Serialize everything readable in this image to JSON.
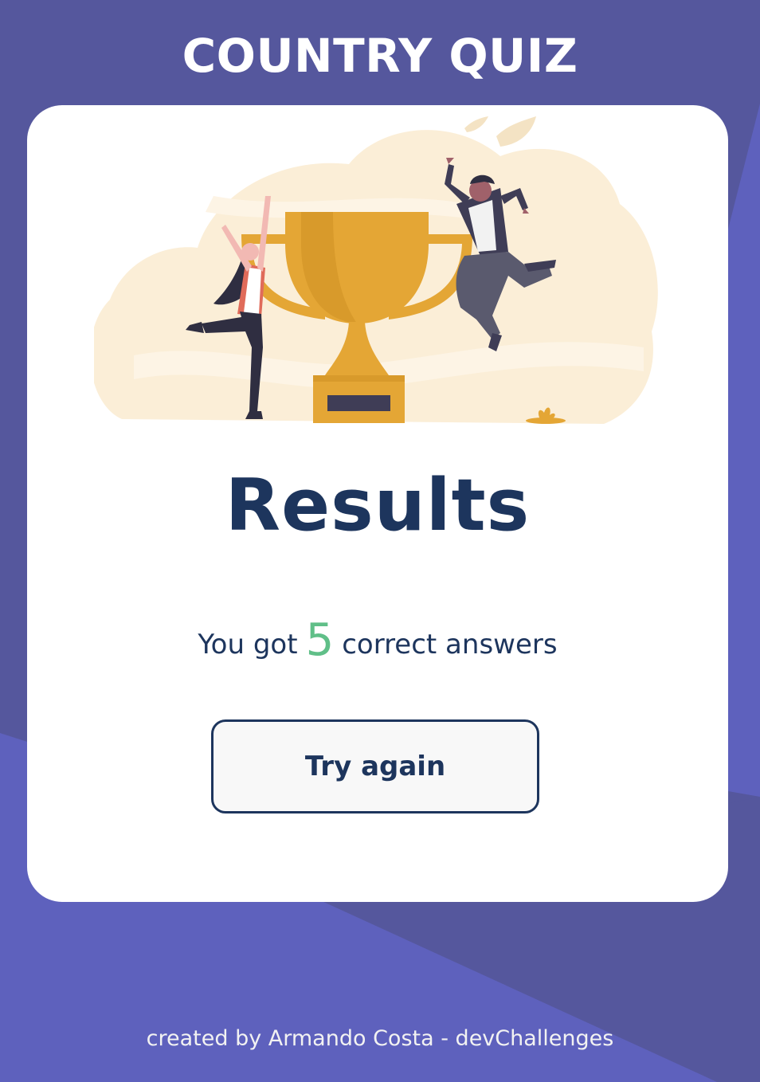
{
  "app": {
    "title": "COUNTRY QUIZ"
  },
  "result": {
    "heading": "Results",
    "prefix": "You got",
    "correct_count": "5",
    "suffix": "correct answers",
    "try_again_label": "Try again"
  },
  "footer": {
    "credit": "created by Armando Costa - devChallenges"
  },
  "colors": {
    "background": "#5e61bd",
    "background_alt": "#55579d",
    "title_text": "#ffffff",
    "heading_text": "#1d355d",
    "correct_count": "#60bf88",
    "button_border": "#1d355d",
    "button_bg": "#f8f8f8",
    "trophy_gold": "#e4a635",
    "illustration_bg": "#fbeed7"
  },
  "icons": {
    "illustration": "winners-trophy-illustration"
  }
}
